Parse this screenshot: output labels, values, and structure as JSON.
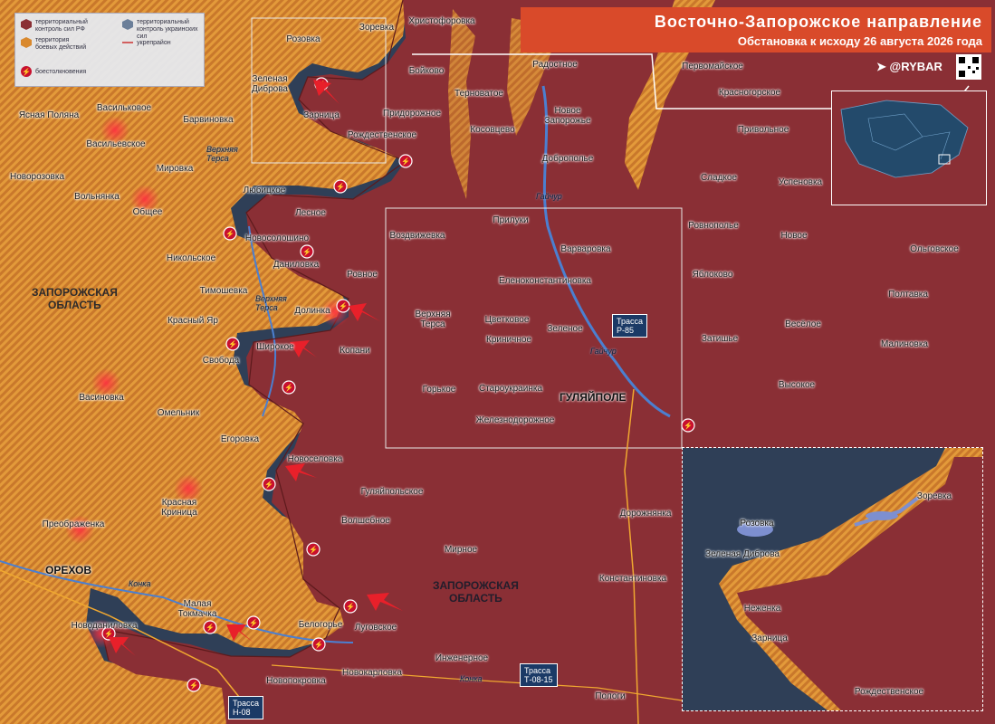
{
  "header": {
    "title": "Восточно-Запорожское направление",
    "subtitle": "Обстановка к исходу 26 августа 2026 года",
    "brand": "@RYBAR"
  },
  "legend": {
    "ru_control": "территориальный\nконтроль сил РФ",
    "ua_control": "территориальный\nконтроль украинских сил",
    "contested": "территория\nбоевых действий",
    "fortified": "укрепрайон",
    "clashes": "боестолкновения"
  },
  "colors": {
    "ru": "#8a2f35",
    "ua": "#2f3f57",
    "contested": "#d9892e",
    "header": "#d94a2a",
    "road": "#1b3a66"
  },
  "regions": {
    "west": "ЗАПОРОЖСКАЯ\nОБЛАСТЬ",
    "east": "ЗАПОРОЖСКАЯ\nОБЛАСТЬ"
  },
  "cities": {
    "gulyaipole": "ГУЛЯЙПОЛЕ",
    "orekhov": "ОРЕХОВ"
  },
  "rivers": {
    "upper_tersa_1": "Верхняя\nТерса",
    "upper_tersa_2": "Верхняя\nТерса",
    "gaichur_1": "Гайчур",
    "gaichur_2": "Гайчур",
    "konka_1": "Конка",
    "konka_2": "Конка"
  },
  "roads": [
    {
      "prefix": "Трасса",
      "code": "Р-85"
    },
    {
      "prefix": "Трасса",
      "code": "Т-08-15"
    },
    {
      "prefix": "Трасса",
      "code": "Н-08"
    }
  ],
  "places": [
    "Христофоровка",
    "Зоревка",
    "Розовка",
    "Бойково",
    "Радостное",
    "Первомайское",
    "Терноватое",
    "Красногорское",
    "Зеленая\nДиброва",
    "Зарница",
    "Придорожное",
    "Новое\nЗапорожье",
    "Косовцево",
    "Привольное",
    "Ясная Поляна",
    "Васильковое",
    "Барвиновка",
    "Рождественское",
    "Доброполье",
    "Васильевское",
    "Мировка",
    "Сладкое",
    "Успеновка",
    "Новорозовка",
    "Вольнянка",
    "Общее",
    "Любицкое",
    "Лесное",
    "Прилуки",
    "Воздвижевка",
    "Ровнополье",
    "Новое",
    "Ольговское",
    "Новосолошино",
    "Варваровка",
    "Никольское",
    "Даниловка",
    "Яблоково",
    "Полтавка",
    "Тимошевка",
    "Ровное",
    "Еленоконстантиновка",
    "Долинка",
    "Верхняя\nТерса",
    "Цветковое",
    "Зеленое",
    "Весёлое",
    "Красный Яр",
    "Широкое",
    "Копани",
    "Затишье",
    "Малиновка",
    "Свобода",
    "Криничное",
    "Горькое",
    "Староукраинка",
    "Васиновка",
    "Высокое",
    "Железнодорожное",
    "Омельник",
    "Егоровка",
    "Новоселовка",
    "Гуляйпольское",
    "Красная\nКриница",
    "Дорожнянка",
    "Волшебное",
    "Преображенка",
    "Мирное",
    "Константиновка",
    "Малая\nТокмачка",
    "Белогорье",
    "Луговское",
    "Новоданиловка",
    "Инженерное",
    "Новокарловка",
    "Новопокровка",
    "Пологи"
  ],
  "inset": {
    "places": [
      "Зоревка",
      "Розовка",
      "Зеленая Диброва",
      "Неженка",
      "Зарница",
      "Рождественское"
    ]
  }
}
